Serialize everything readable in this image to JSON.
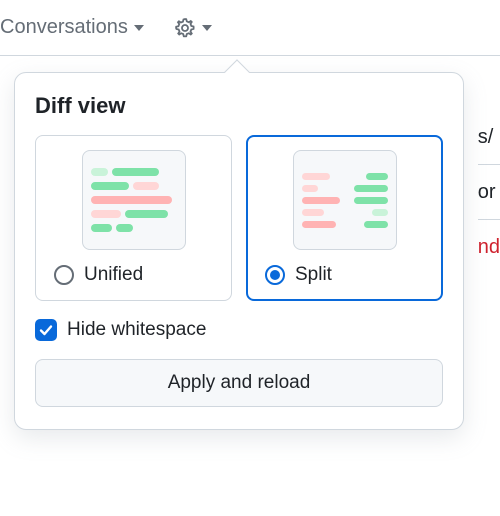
{
  "toolbar": {
    "conversations_label": "Conversations"
  },
  "popover": {
    "title": "Diff view",
    "options": {
      "unified": {
        "label": "Unified",
        "selected": false
      },
      "split": {
        "label": "Split",
        "selected": true
      }
    },
    "hide_whitespace": {
      "label": "Hide whitespace",
      "checked": true
    },
    "apply_button": "Apply and reload"
  },
  "background": {
    "line1": "s/",
    "line2": "or",
    "line3": "nd"
  }
}
